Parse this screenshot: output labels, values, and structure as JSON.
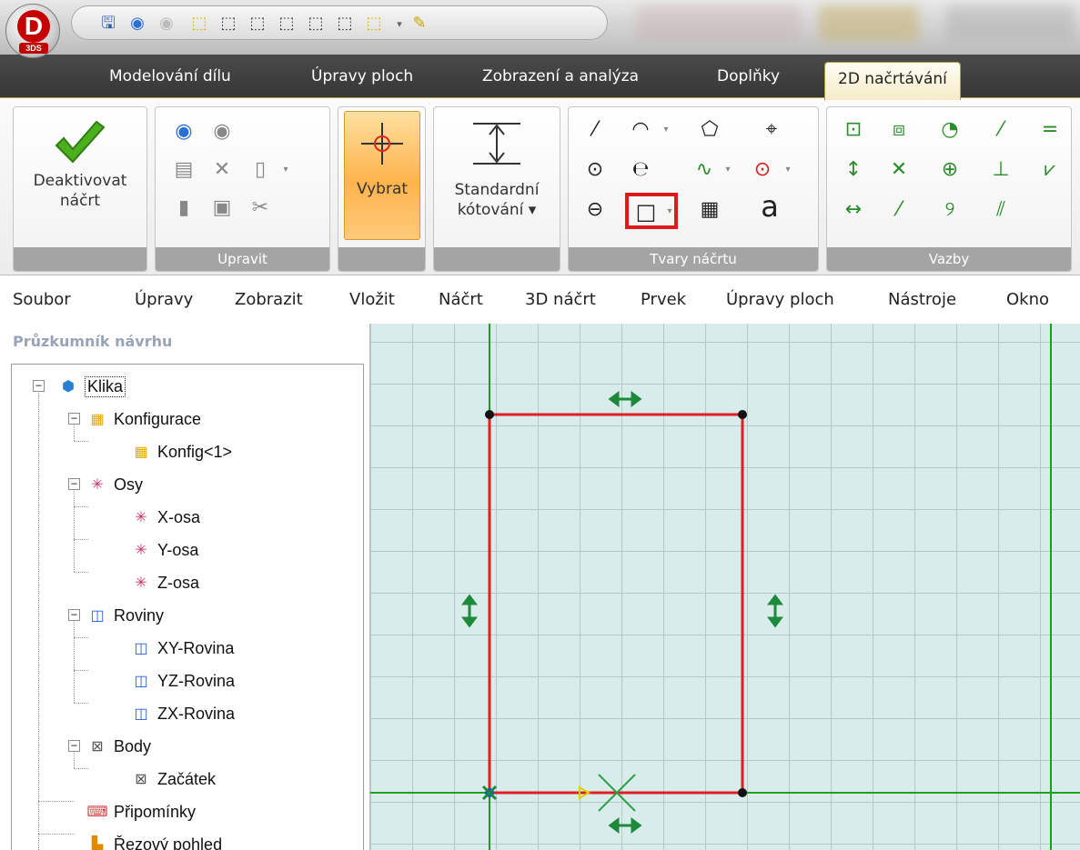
{
  "app": {
    "logo_letter": "D",
    "logo_sub": "3DS"
  },
  "tabs": [
    {
      "label": "Modelování dílu",
      "active": false
    },
    {
      "label": "Úpravy ploch",
      "active": false
    },
    {
      "label": "Zobrazení a analýza",
      "active": false
    },
    {
      "label": "Doplňky",
      "active": false
    },
    {
      "label": "2D načrtávání",
      "active": true
    }
  ],
  "ribbon": {
    "deactivate": {
      "line1": "Deaktivovat",
      "line2": "náčrt"
    },
    "edit_group_label": "Upravit",
    "select_label": "Vybrat",
    "dimension": {
      "line1": "Standardní",
      "line2": "kótování ▾"
    },
    "shapes_group_label": "Tvary náčrtu",
    "text_tool_glyph": "a",
    "constraints_group_label": "Vazby"
  },
  "menu": [
    "Soubor",
    "Úpravy",
    "Zobrazit",
    "Vložit",
    "Náčrt",
    "3D náčrt",
    "Prvek",
    "Úpravy ploch",
    "Nástroje",
    "Okno"
  ],
  "explorer": {
    "title": "Průzkumník návrhu",
    "items": [
      {
        "label": "Klika",
        "icon": "part-icon"
      },
      {
        "label": "Konfigurace",
        "icon": "configuration-icon"
      },
      {
        "label": "Konfig<1>",
        "icon": "configuration-icon"
      },
      {
        "label": "Osy",
        "icon": "axes-icon"
      },
      {
        "label": "X-osa",
        "icon": "axis-icon"
      },
      {
        "label": "Y-osa",
        "icon": "axis-icon"
      },
      {
        "label": "Z-osa",
        "icon": "axis-icon"
      },
      {
        "label": "Roviny",
        "icon": "planes-icon"
      },
      {
        "label": "XY-Rovina",
        "icon": "plane-icon"
      },
      {
        "label": "YZ-Rovina",
        "icon": "plane-icon"
      },
      {
        "label": "ZX-Rovina",
        "icon": "plane-icon"
      },
      {
        "label": "Body",
        "icon": "points-icon"
      },
      {
        "label": "Začátek",
        "icon": "point-icon"
      },
      {
        "label": "Připomínky",
        "icon": "notes-icon"
      },
      {
        "label": "Řezový pohled",
        "icon": "section-view-icon"
      }
    ]
  },
  "colors": {
    "sketch_line": "#e02020",
    "constraint": "#1c8a3a",
    "grid_bg": "#d9ecec",
    "axis": "#1aa01a",
    "highlight_box": "#e01818"
  }
}
